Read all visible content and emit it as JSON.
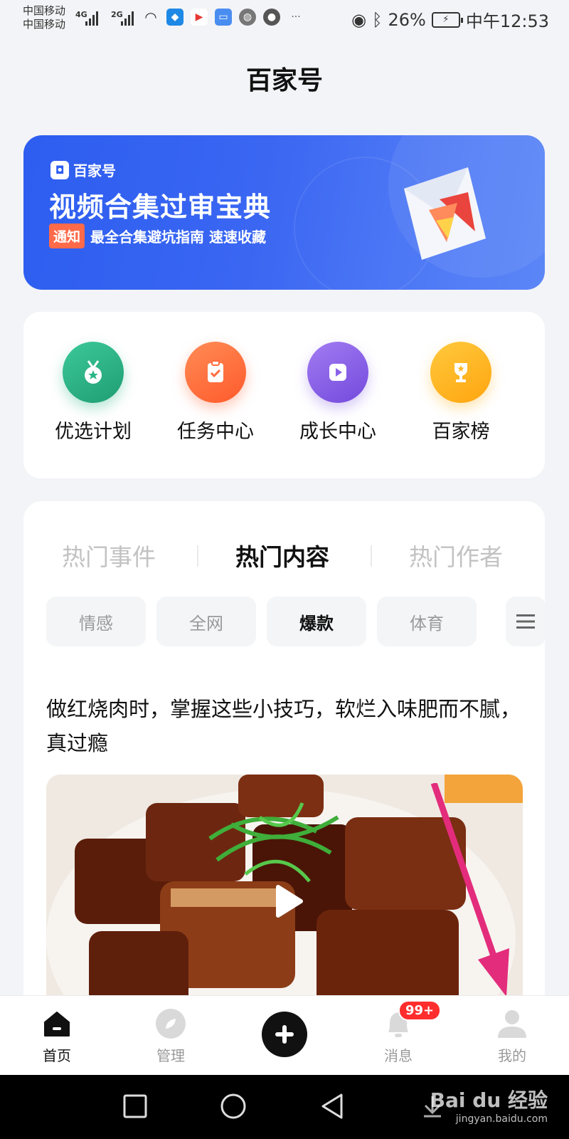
{
  "status_bar": {
    "carrier_1": "中国移动",
    "carrier_2": "中国移动",
    "net_1": "4G",
    "net_2": "2G",
    "battery": "26%",
    "time": "中午12:53"
  },
  "header": {
    "title": "百家号"
  },
  "banner": {
    "brand": "百家号",
    "headline": "视频合集过审宝典",
    "tag": "通知",
    "subtitle": "最全合集避坑指南 速速收藏",
    "colors": {
      "bg": "#2d5ef0",
      "tag": "#ff6a4a"
    }
  },
  "entries": [
    {
      "label": "优选计划",
      "icon": "medal-icon",
      "color": "#2bb487"
    },
    {
      "label": "任务中心",
      "icon": "clipboard-check-icon",
      "color": "#ff6b3d"
    },
    {
      "label": "成长中心",
      "icon": "video-play-icon",
      "color": "#8a63e6"
    },
    {
      "label": "百家榜",
      "icon": "trophy-icon",
      "color": "#ffb51f"
    }
  ],
  "hot": {
    "tabs": [
      {
        "label": "热门事件",
        "active": false
      },
      {
        "label": "热门内容",
        "active": true
      },
      {
        "label": "热门作者",
        "active": false
      }
    ],
    "chips": [
      {
        "label": "情感",
        "active": false
      },
      {
        "label": "全网",
        "active": false
      },
      {
        "label": "爆款",
        "active": true
      },
      {
        "label": "体育",
        "active": false
      }
    ],
    "article": {
      "title": "做红烧肉时，掌握这些小技巧，软烂入味肥而不腻，真过瘾"
    }
  },
  "bottom_nav": {
    "items": [
      {
        "label": "首页",
        "icon": "home-icon",
        "active": true
      },
      {
        "label": "管理",
        "icon": "compass-icon",
        "active": false
      },
      {
        "label": "消息",
        "icon": "bell-icon",
        "active": false
      },
      {
        "label": "我的",
        "icon": "user-icon",
        "active": false
      }
    ],
    "badge": "99+"
  },
  "watermark": {
    "text": "Bai du 经验",
    "url": "jingyan.baidu.com"
  }
}
